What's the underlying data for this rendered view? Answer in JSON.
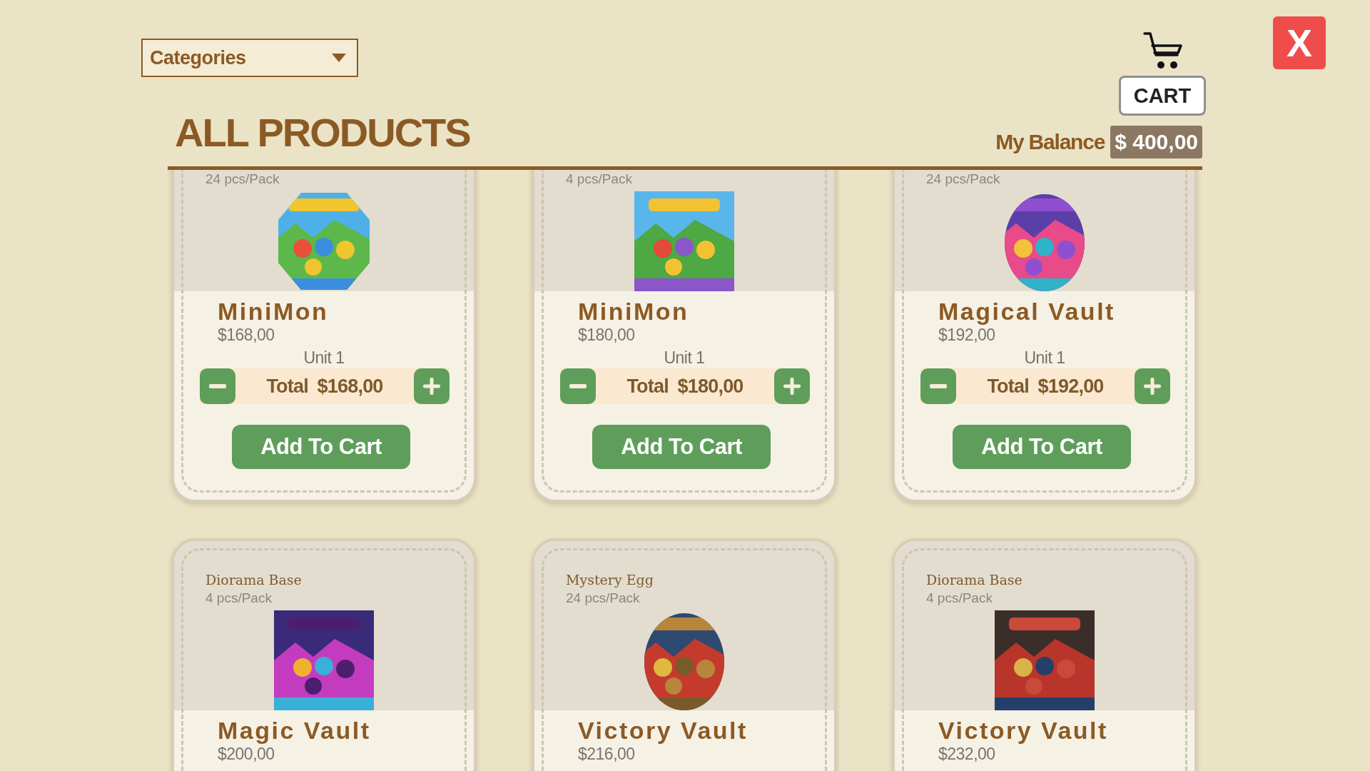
{
  "header": {
    "categories_dropdown": "Categories",
    "cart_label": "CART",
    "close_label": "X",
    "title": "ALL PRODUCTS",
    "balance_label": "My Balance",
    "balance_value": "$ 400,00"
  },
  "products": [
    {
      "pack": "24 pcs/Pack",
      "name": "MiniMon",
      "price": "$168,00",
      "unit": "Unit 1",
      "total": "Total $168,00",
      "button": "Add To Cart"
    },
    {
      "pack": "4 pcs/Pack",
      "name": "MiniMon",
      "price": "$180,00",
      "unit": "Unit 1",
      "total": "Total $180,00",
      "button": "Add To Cart"
    },
    {
      "pack": "24 pcs/Pack",
      "name": "Magical Vault",
      "price": "$192,00",
      "unit": "Unit 1",
      "total": "Total $192,00",
      "button": "Add To Cart"
    },
    {
      "category": "Diorama Base",
      "pack": "4 pcs/Pack",
      "name": "Magic Vault",
      "price": "$200,00"
    },
    {
      "category": "Mystery Egg",
      "pack": "24 pcs/Pack",
      "name": "Victory Vault",
      "price": "$216,00"
    },
    {
      "category": "Diorama Base",
      "pack": "4 pcs/Pack",
      "name": "Victory Vault",
      "price": "$232,00"
    }
  ]
}
